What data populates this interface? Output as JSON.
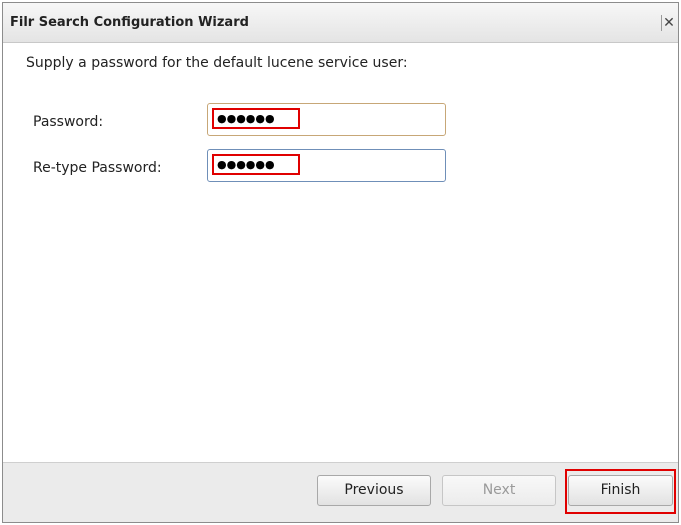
{
  "dialog": {
    "title": "Filr Search Configuration Wizard",
    "close_glyph": "✕"
  },
  "content": {
    "instruction": "Supply a password for the default lucene service user:",
    "password_label": "Password:",
    "password_value": "●●●●●●",
    "retype_label": "Re-type Password:",
    "retype_value": "●●●●●●"
  },
  "footer": {
    "previous_label": "Previous",
    "next_label": "Next",
    "finish_label": "Finish"
  },
  "colors": {
    "highlight": "#e00000"
  }
}
